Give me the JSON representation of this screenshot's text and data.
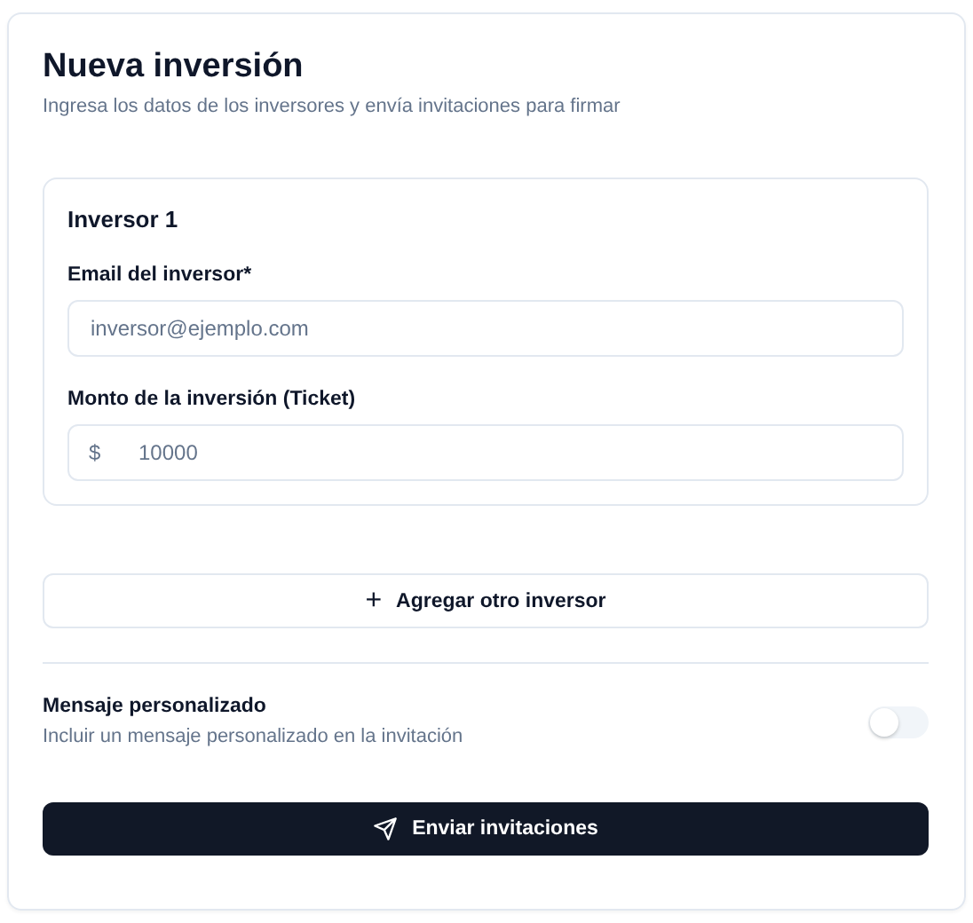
{
  "title": "Nueva inversión",
  "subtitle": "Ingresa los datos de los inversores y envía invitaciones para firmar",
  "investors": [
    {
      "heading": "Inversor 1",
      "email_label": "Email del inversor*",
      "email_placeholder": "inversor@ejemplo.com",
      "amount_label": "Monto de la inversión (Ticket)",
      "currency": "$",
      "amount_placeholder": "10000"
    }
  ],
  "add_button": {
    "icon": "+",
    "label": "Agregar otro inversor"
  },
  "custom_message": {
    "label": "Mensaje personalizado",
    "description": "Incluir un mensaje personalizado en la invitación",
    "on": false
  },
  "send_button": {
    "label": "Enviar invitaciones"
  }
}
